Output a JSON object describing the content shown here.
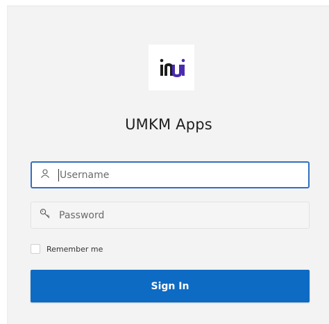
{
  "app": {
    "title": "UMKM Apps",
    "logo_text": "inui"
  },
  "form": {
    "username": {
      "placeholder": "Username",
      "value": "",
      "icon": "user-icon"
    },
    "password": {
      "placeholder": "Password",
      "value": "",
      "icon": "key-icon"
    },
    "remember": {
      "label": "Remember me",
      "checked": false
    },
    "submit_label": "Sign In"
  },
  "colors": {
    "primary": "#0d6bc3",
    "focus_border": "#2f6fc4",
    "logo_dark": "#1c1c1c",
    "logo_purple": "#4a2bb0"
  }
}
